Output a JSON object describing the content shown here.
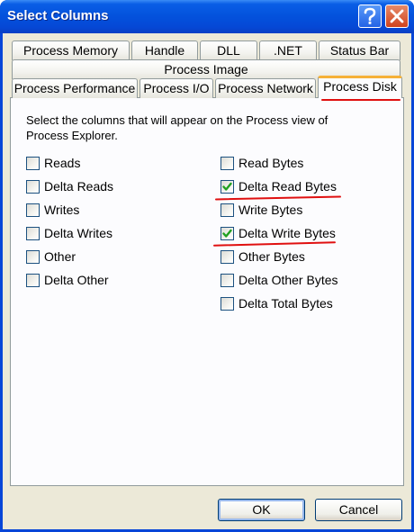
{
  "window": {
    "title": "Select Columns"
  },
  "tabs": {
    "row1": [
      "Process Memory",
      "Handle",
      "DLL",
      ".NET",
      "Status Bar"
    ],
    "row2": [
      "Process Image"
    ],
    "row3": [
      "Process Performance",
      "Process I/O",
      "Process Network",
      "Process Disk"
    ],
    "active": "Process Disk"
  },
  "panel": {
    "description": "Select the columns that will appear on the Process view of Process Explorer.",
    "left_options": [
      {
        "label": "Reads",
        "checked": false
      },
      {
        "label": "Delta Reads",
        "checked": false
      },
      {
        "label": "Writes",
        "checked": false
      },
      {
        "label": "Delta Writes",
        "checked": false
      },
      {
        "label": "Other",
        "checked": false
      },
      {
        "label": "Delta Other",
        "checked": false
      }
    ],
    "right_options": [
      {
        "label": "Read Bytes",
        "checked": false
      },
      {
        "label": "Delta Read Bytes",
        "checked": true
      },
      {
        "label": "Write Bytes",
        "checked": false
      },
      {
        "label": "Delta Write Bytes",
        "checked": true
      },
      {
        "label": "Other Bytes",
        "checked": false
      },
      {
        "label": "Delta Other Bytes",
        "checked": false
      },
      {
        "label": "Delta Total Bytes",
        "checked": false
      }
    ]
  },
  "buttons": {
    "ok": "OK",
    "cancel": "Cancel"
  },
  "colors": {
    "titlebar": "#0453dd",
    "dialog_bg": "#ece9d8",
    "check": "#21a121",
    "annotation": "#e01010",
    "active_tab_accent": "#f5b138"
  }
}
